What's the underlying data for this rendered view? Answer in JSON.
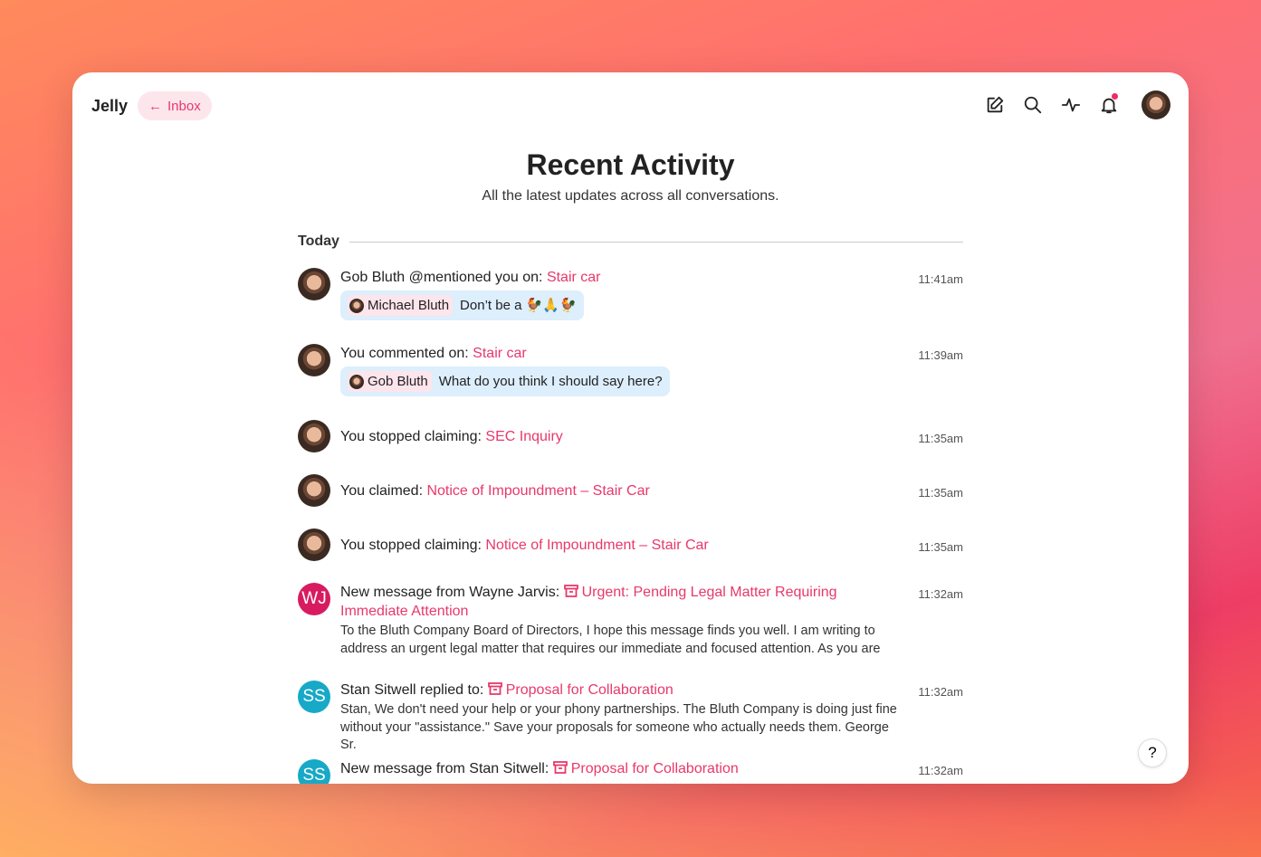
{
  "header": {
    "brand": "Jelly",
    "back_label": "Inbox",
    "icons": [
      "compose-icon",
      "search-icon",
      "activity-icon",
      "bell-icon",
      "avatar"
    ],
    "notification_dot_color": "#ef2b62"
  },
  "page": {
    "title": "Recent Activity",
    "subtitle": "All the latest updates across all conversations.",
    "section": "Today"
  },
  "colors": {
    "accent": "#e8386a",
    "wj": "#d81b60",
    "ss": "#17a9c7"
  },
  "items": [
    {
      "text": "Gob Bluth @mentioned you on: ",
      "link": "Stair car",
      "time": "11:41am",
      "quote_author": "Michael Bluth",
      "quote_text": "Don’t be a 🐓🙏🐓"
    },
    {
      "text": "You commented on: ",
      "link": "Stair car",
      "time": "11:39am",
      "quote_author": "Gob Bluth",
      "quote_text": "What do you think I should say here?"
    },
    {
      "text": "You stopped claiming: ",
      "link": "SEC Inquiry",
      "time": "11:35am"
    },
    {
      "text": "You claimed: ",
      "link": "Notice of Impoundment – Stair Car",
      "time": "11:35am"
    },
    {
      "text": "You stopped claiming: ",
      "link": "Notice of Impoundment – Stair Car",
      "time": "11:35am"
    },
    {
      "initials": "WJ",
      "text": "New message from Wayne Jarvis: ",
      "link": "Urgent: Pending Legal Matter Requiring Immediate Attention",
      "time": "11:32am",
      "snippet": "To the Bluth Company Board of Directors, I hope this message finds you well. I am writing to address an urgent legal matter that requires our immediate and focused attention. As you are"
    },
    {
      "initials": "SS",
      "text": "Stan Sitwell replied to: ",
      "link": "Proposal for Collaboration",
      "time": "11:32am",
      "snippet": "Stan, We don't need your help or your phony partnerships. The Bluth Company is doing just fine without your \"assistance.\" Save your proposals for someone who actually needs them. George Sr."
    },
    {
      "initials": "SS",
      "text": "New message from Stan Sitwell: ",
      "link": "Proposal for Collaboration",
      "time": "11:32am"
    }
  ],
  "help": "?"
}
